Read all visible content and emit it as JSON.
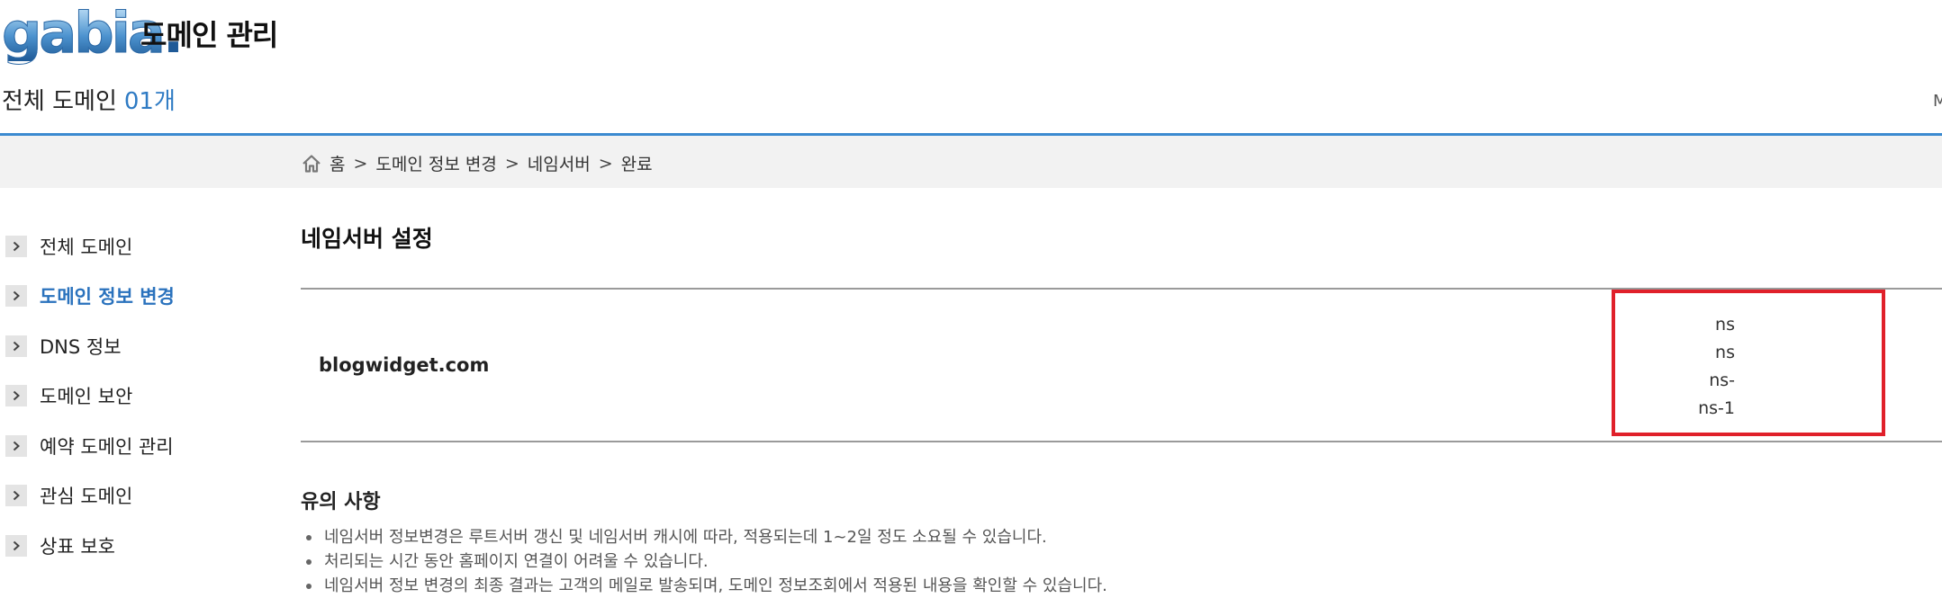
{
  "header": {
    "logo_text": "gabia",
    "logo_dot": ".",
    "title": "도메인 관리",
    "total_label": "전체 도메인",
    "total_count": "01개",
    "edge_letter": "M"
  },
  "breadcrumb": {
    "items": [
      "홈",
      "도메인 정보 변경",
      "네임서버",
      "완료"
    ],
    "separator": ">"
  },
  "sidebar": {
    "items": [
      {
        "label": "전체 도메인"
      },
      {
        "label": "도메인 정보 변경"
      },
      {
        "label": "DNS 정보"
      },
      {
        "label": "도메인 보안"
      },
      {
        "label": "예약 도메인 관리"
      },
      {
        "label": "관심 도메인"
      },
      {
        "label": "상표 보호"
      }
    ],
    "active_index": 1
  },
  "main": {
    "section_title": "네임서버 설정",
    "domain": "blogwidget.com",
    "nameservers": [
      "ns",
      "ns",
      "ns-",
      "ns-1"
    ],
    "notice_title": "유의 사항",
    "notices": [
      "네임서버 정보변경은 루트서버 갱신 및 네임서버 캐시에 따라, 적용되는데 1~2일 정도 소요될 수 있습니다.",
      "처리되는 시간 동안 홈페이지 연결이 어려울 수 있습니다.",
      "네임서버 정보 변경의 최종 결과는 고객의 메일로 발송되며, 도메인 정보조회에서 적용된 내용을 확인할 수 있습니다."
    ]
  },
  "colors": {
    "accent": "#2a72bd",
    "header_rule": "#3b8ad0",
    "highlight_box": "#e0202a",
    "crumb_bg": "#f2f2f2"
  },
  "icons": {
    "home": "home-icon",
    "chevron": "chevron-right-icon"
  }
}
